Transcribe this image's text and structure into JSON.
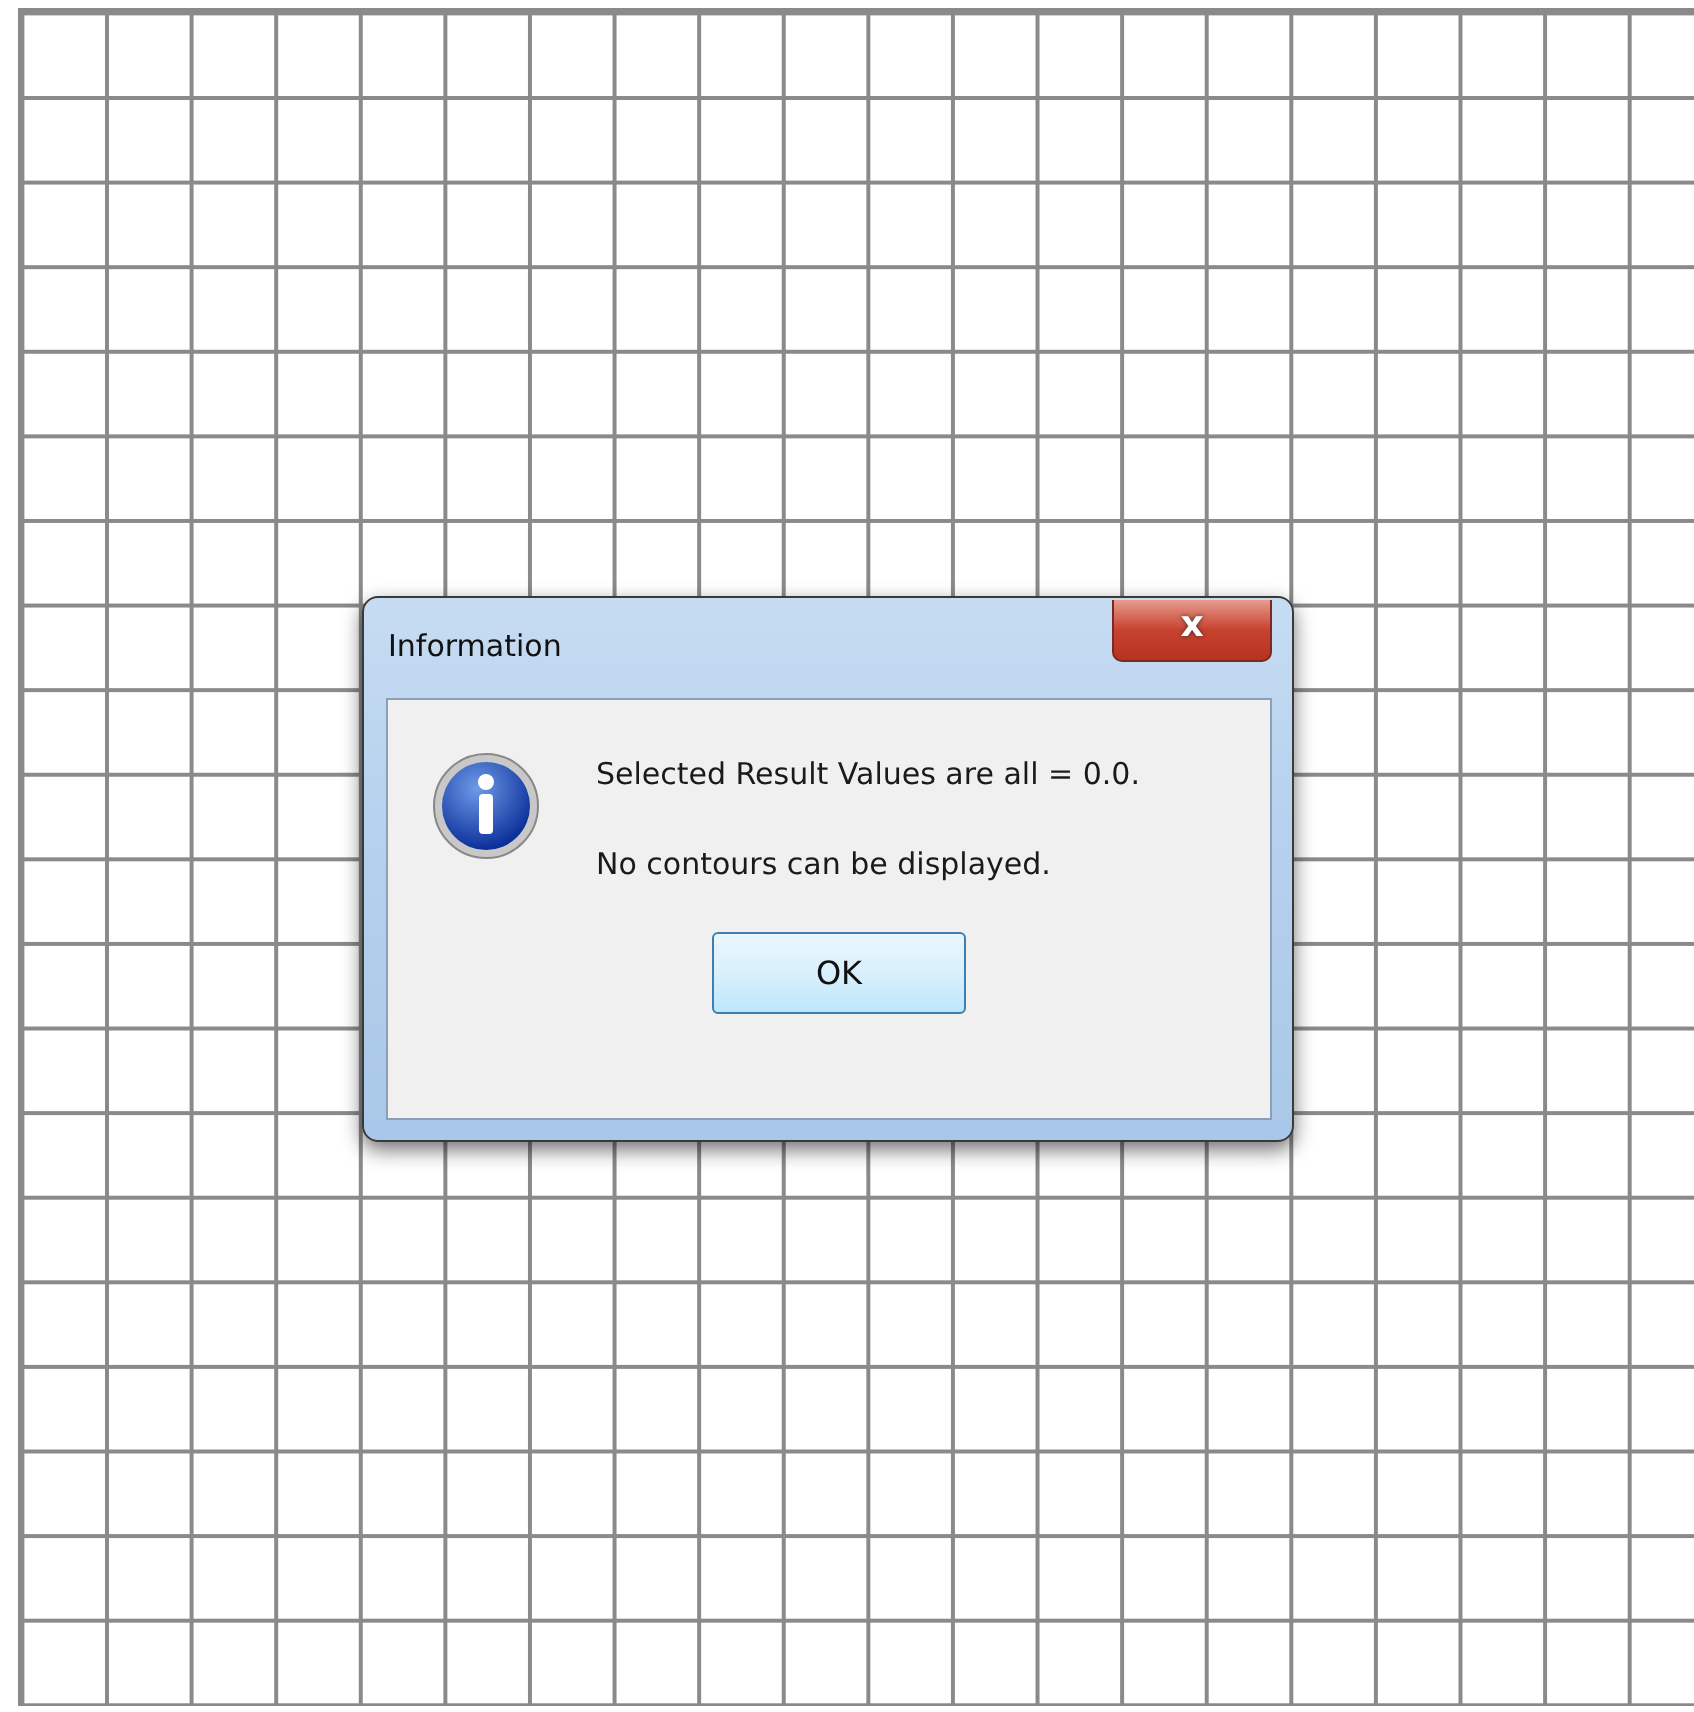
{
  "dialog": {
    "title": "Information",
    "close_label": "x",
    "messages": [
      "Selected Result Values are all = 0.0.",
      "No contours can be displayed."
    ],
    "buttons": [
      {
        "label": "OK",
        "default": true
      }
    ]
  }
}
